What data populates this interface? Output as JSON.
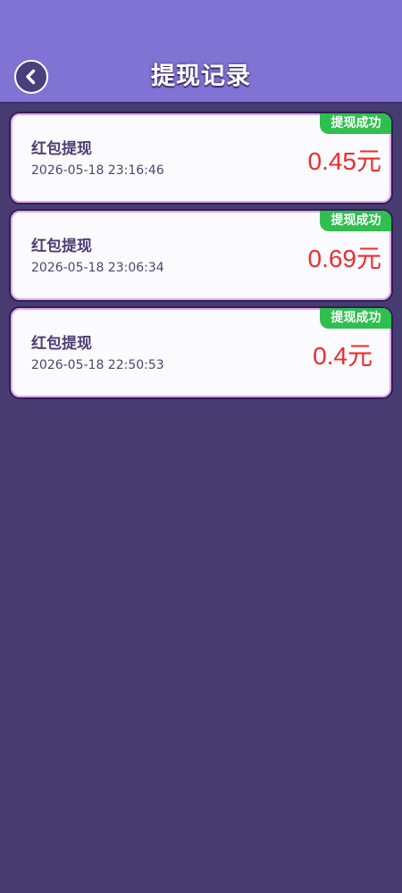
{
  "header": {
    "title": "提现记录",
    "back_icon": "chevron-left-icon"
  },
  "records": [
    {
      "title": "红包提现",
      "time": "2026-05-18 23:16:46",
      "amount": "0.45元",
      "status": "提现成功"
    },
    {
      "title": "红包提现",
      "time": "2026-05-18 23:06:34",
      "amount": "0.69元",
      "status": "提现成功"
    },
    {
      "title": "红包提现",
      "time": "2026-05-18 22:50:53",
      "amount": "0.4元",
      "status": "提现成功"
    }
  ],
  "colors": {
    "header_bg": "#8173d4",
    "page_bg": "#463c72",
    "amount": "#ee2c2c",
    "badge": "#2fbf4f"
  }
}
